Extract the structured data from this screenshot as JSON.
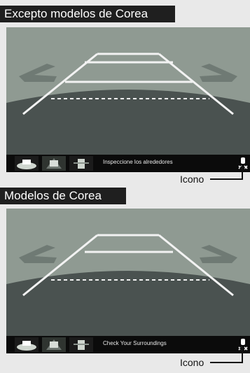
{
  "sections": [
    {
      "title": "Excepto modelos de Corea",
      "message": "Inspeccione los alrededores",
      "icon_label": "Icono",
      "camera_view_buttons": [
        "normal-view",
        "wide-view",
        "top-down-view"
      ],
      "icon": "camera-guideline-icon"
    },
    {
      "title": "Modelos de Corea",
      "message": "Check Your Surroundings",
      "icon_label": "Icono",
      "camera_view_buttons": [
        "normal-view",
        "wide-view",
        "top-down-view"
      ],
      "icon": "camera-guideline-icon"
    }
  ],
  "colors": {
    "title_bg": "#1f1f1f",
    "screen_upper": "#8f9a92",
    "screen_lower": "#4a5250",
    "guideline": "#f2f2f2",
    "arrow": "#6f7a74"
  }
}
